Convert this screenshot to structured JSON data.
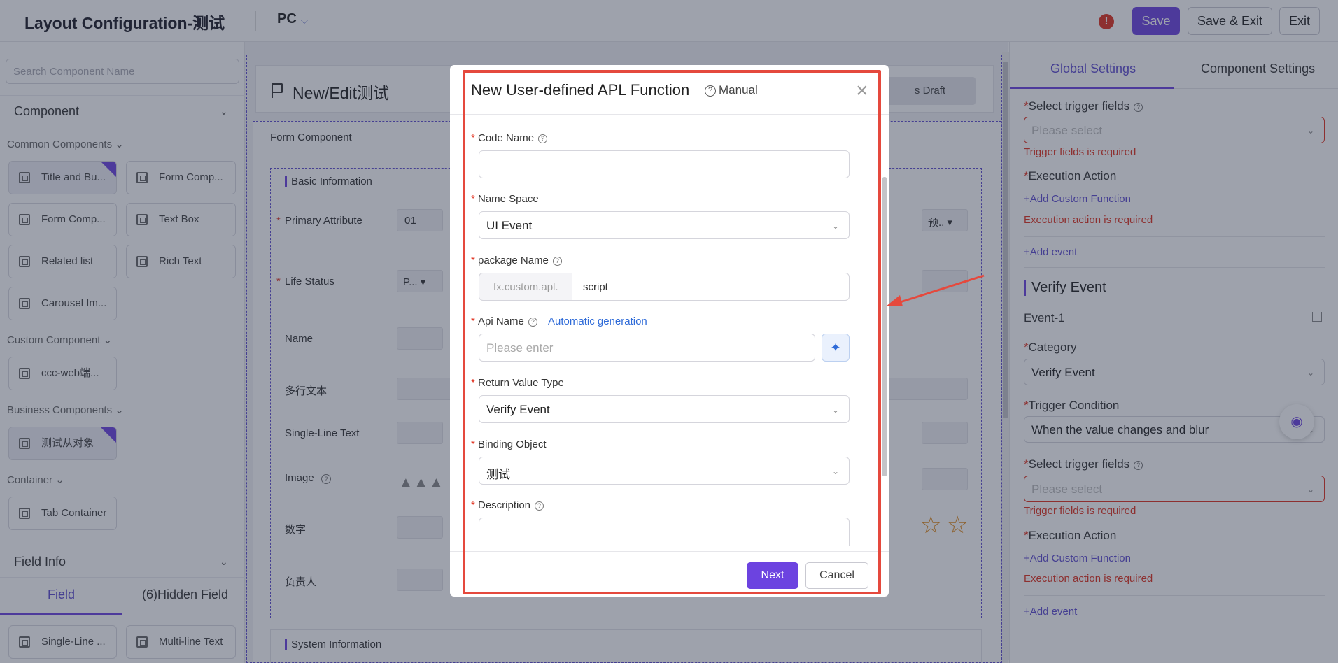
{
  "header": {
    "title": "Layout Configuration-测试",
    "device": "PC",
    "save": "Save",
    "save_exit": "Save & Exit",
    "exit": "Exit",
    "warning": "!"
  },
  "left": {
    "search_placeholder": "Search Component Name",
    "component_section": "Component",
    "groups": {
      "common": "Common Components",
      "custom": "Custom Component",
      "business": "Business Components",
      "container": "Container"
    },
    "components": [
      "Title and Bu...",
      "Form Comp...",
      "Form Comp...",
      "Text Box",
      "Related list",
      "Rich Text",
      "Carousel Im...",
      "ccc-web端...",
      "测试从对象",
      "Tab Container"
    ],
    "field_info": "Field Info",
    "tabs": [
      "Field",
      "(6)Hidden Field"
    ],
    "fields": [
      "Single-Line ...",
      "Multi-line Text"
    ]
  },
  "canvas": {
    "page_title": "New/Edit测试",
    "draft": "s Draft",
    "form_component": "Form Component",
    "basic_info": "Basic Information",
    "rows": [
      "Primary Attribute",
      "Life Status",
      "Name",
      "多行文本",
      "Single-Line Text",
      "Image",
      "数字",
      "负责人"
    ],
    "primary_value": "01",
    "life_status_value": "P...",
    "preset_value": "预..",
    "system_info": "System Information"
  },
  "right": {
    "tabs": [
      "Global Settings",
      "Component Settings"
    ],
    "select_trigger": "Select trigger fields",
    "please_select": "Please select",
    "trigger_err": "Trigger fields is required",
    "exec_action": "Execution Action",
    "add_custom_fn": "+Add Custom Function",
    "exec_err": "Execution action is required",
    "add_event": "+Add event",
    "verify_event_title": "Verify Event",
    "event1": "Event-1",
    "category": "Category",
    "category_value": "Verify Event",
    "trigger_condition": "Trigger Condition",
    "trigger_condition_value": "When the value changes and blur"
  },
  "modal": {
    "title": "New User-defined APL Function",
    "manual": "Manual",
    "code_name": "Code Name",
    "name_space": "Name Space",
    "name_space_value": "UI Event",
    "package_name": "package Name",
    "package_prefix": "fx.custom.apl.",
    "package_value": "script",
    "api_name": "Api Name",
    "auto_gen": "Automatic generation",
    "api_placeholder": "Please enter",
    "return_type": "Return Value Type",
    "return_type_value": "Verify Event",
    "binding_object": "Binding Object",
    "binding_object_value": "测试",
    "description": "Description",
    "next": "Next",
    "cancel": "Cancel"
  },
  "colors": {
    "accent": "#6c43e0",
    "error": "#e0301e",
    "link": "#2f6bd8",
    "highlight": "#e5493d"
  }
}
